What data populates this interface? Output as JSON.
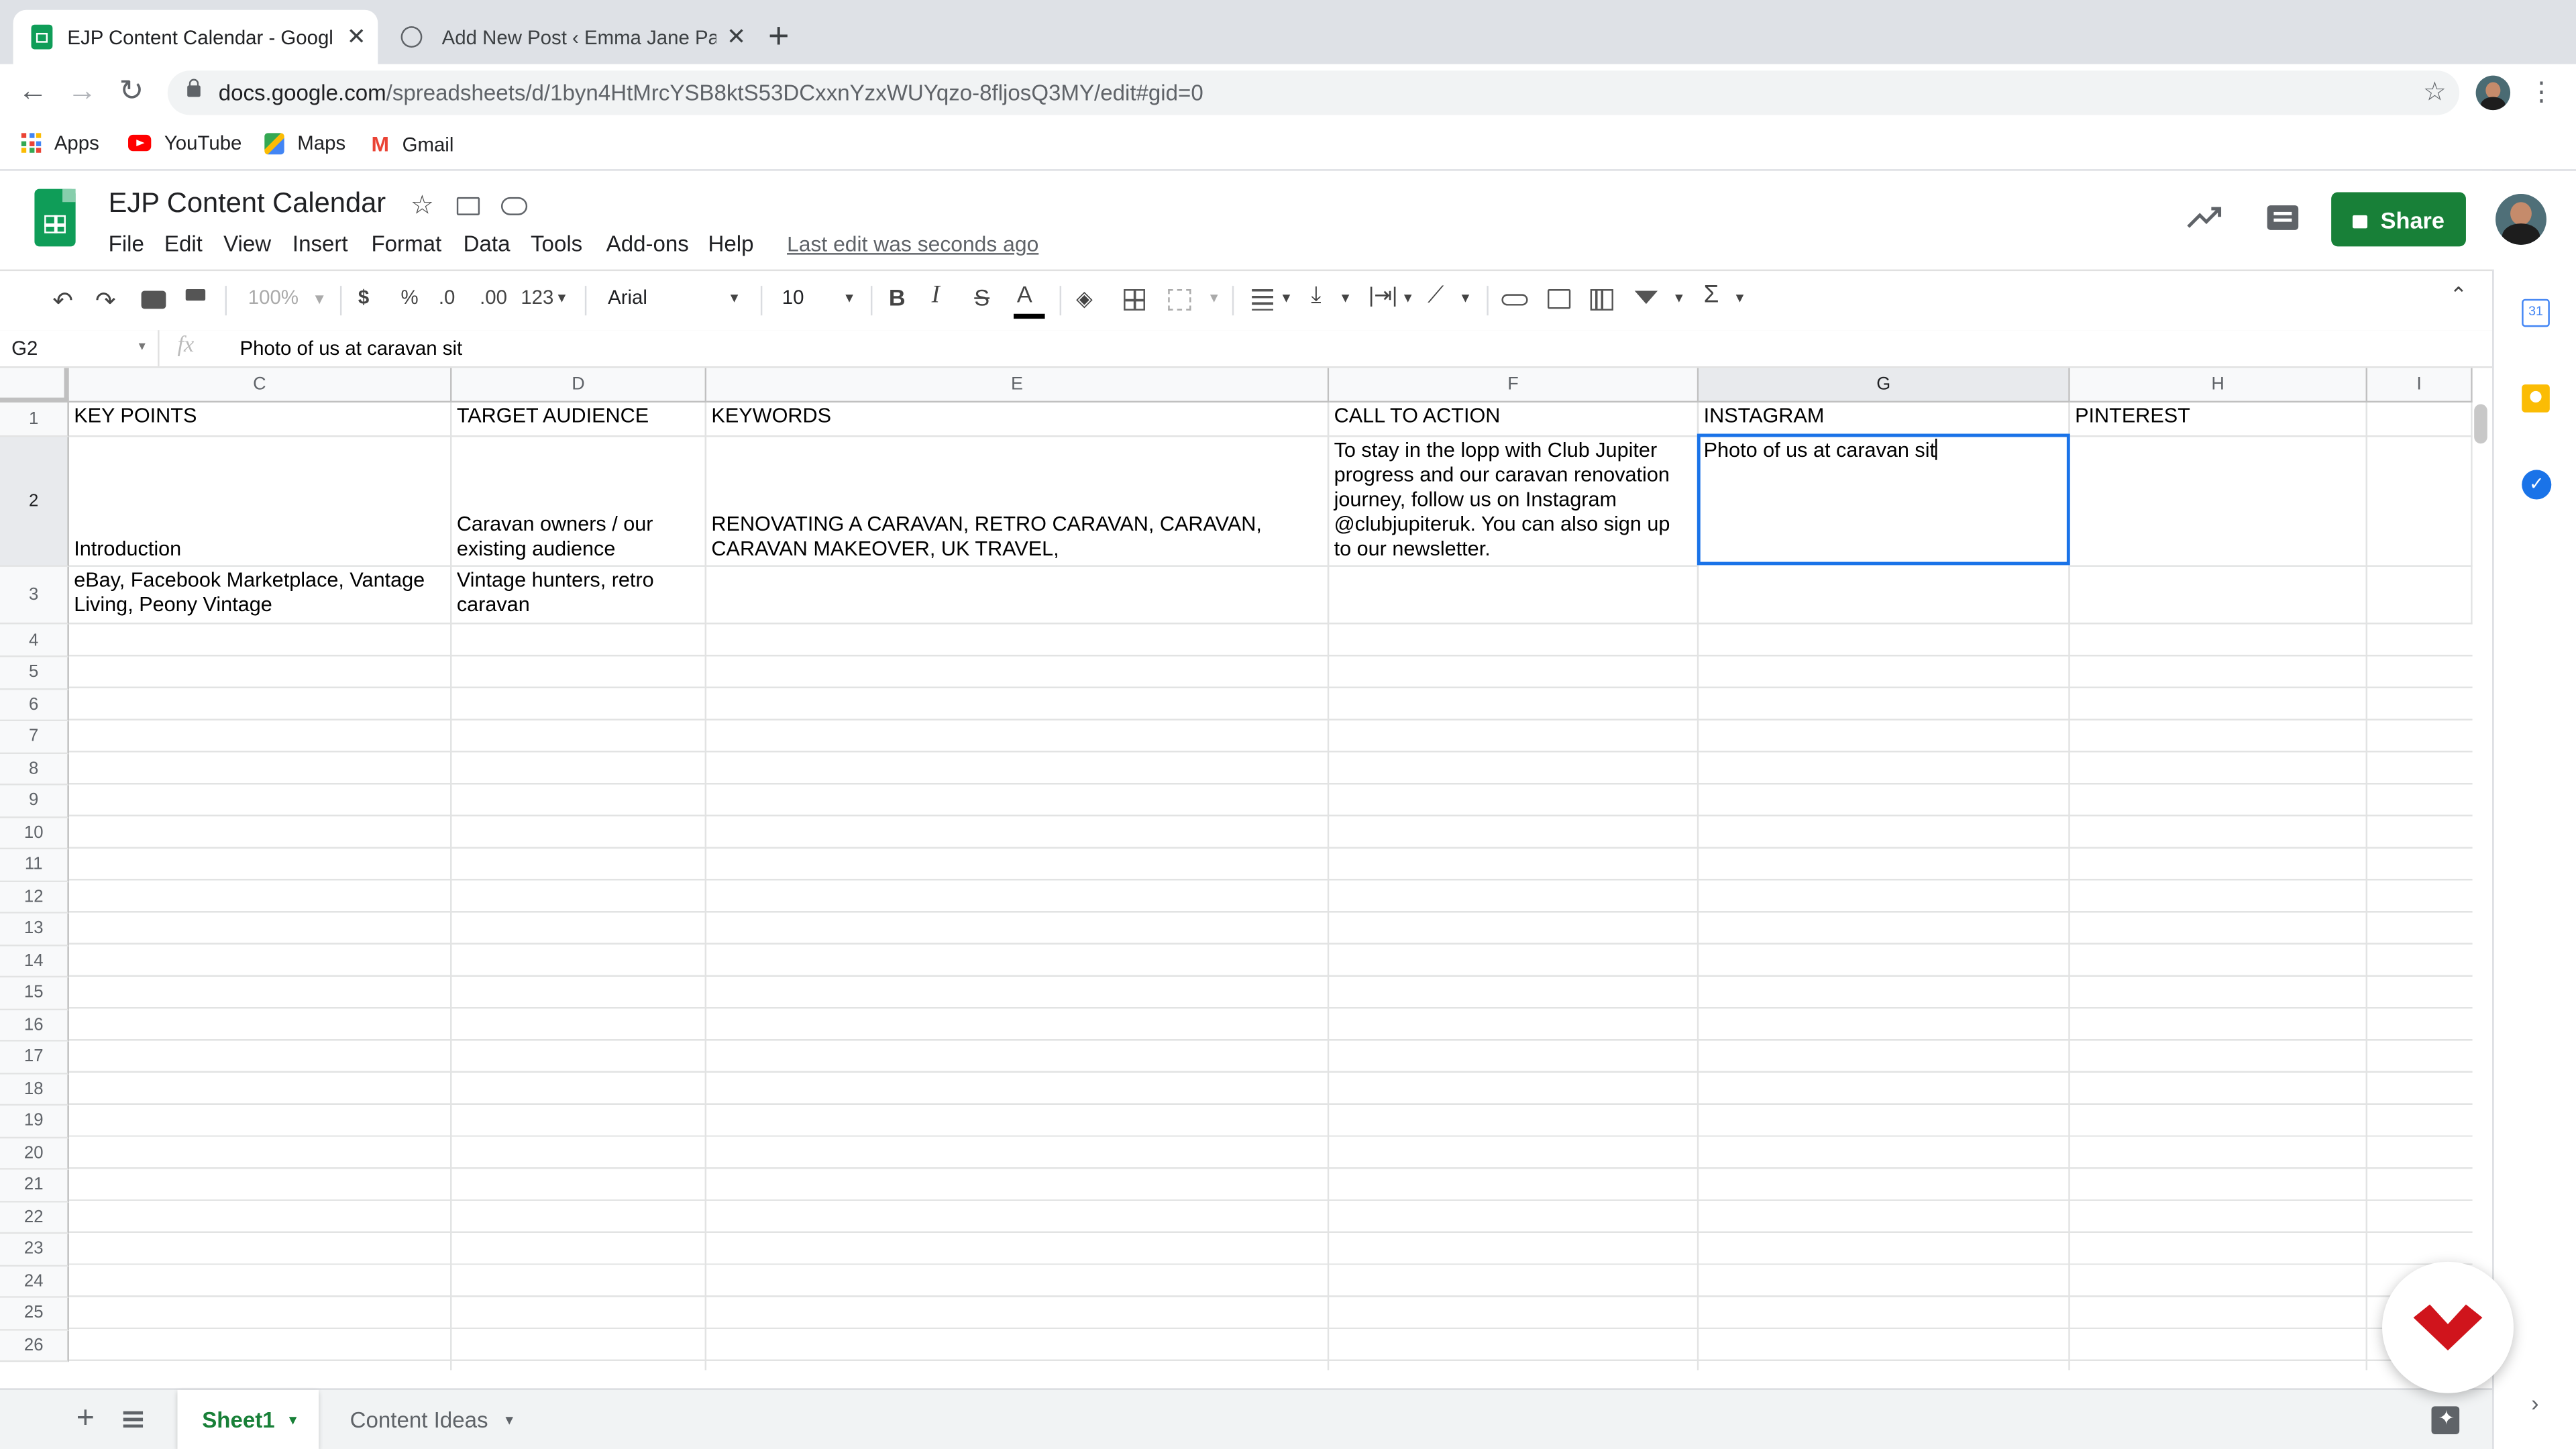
{
  "browser": {
    "tabs": [
      {
        "title": "EJP Content Calendar - Google",
        "active": true
      },
      {
        "title": "Add New Post ‹ Emma Jane Pa",
        "active": false
      }
    ],
    "url_host": "docs.google.com",
    "url_path": "/spreadsheets/d/1byn4HtMrcYSB8ktS53DCxxnYzxWUYqzo-8fljosQ3MY/edit#gid=0",
    "bookmarks": [
      "Apps",
      "YouTube",
      "Maps",
      "Gmail"
    ]
  },
  "doc": {
    "title": "EJP Content Calendar",
    "menu": [
      "File",
      "Edit",
      "View",
      "Insert",
      "Format",
      "Data",
      "Tools",
      "Add-ons",
      "Help"
    ],
    "last_edit": "Last edit was seconds ago",
    "share_label": "Share"
  },
  "toolbar": {
    "zoom": "100%",
    "currency": "$",
    "percent": "%",
    "dec_less": ".0",
    "dec_more": ".00",
    "format_more": "123",
    "font": "Arial",
    "font_size": "10"
  },
  "formula_bar": {
    "cell_ref": "G2",
    "fx": "fx",
    "content": "Photo of us at caravan sit"
  },
  "grid": {
    "columns": [
      "C",
      "D",
      "E",
      "F",
      "G",
      "H",
      "I"
    ],
    "rows": [
      "1",
      "2",
      "3",
      "4",
      "5",
      "6",
      "7",
      "8",
      "9",
      "10",
      "11",
      "12",
      "13",
      "14",
      "15",
      "16",
      "17",
      "18",
      "19",
      "20",
      "21",
      "22",
      "23",
      "24",
      "25",
      "26"
    ],
    "headers": {
      "c": "KEY POINTS",
      "d": "TARGET AUDIENCE",
      "e": "KEYWORDS",
      "f": "CALL TO ACTION",
      "g": "INSTAGRAM",
      "h": "PINTEREST"
    },
    "row2": {
      "c": "Introduction",
      "d": "Caravan owners / our existing audience",
      "e": "RENOVATING A CARAVAN, RETRO CARAVAN, CARAVAN, CARAVAN MAKEOVER, UK TRAVEL,",
      "f": "To stay in the lopp with Club Jupiter progress and our caravan renovation journey, follow us on Instagram @clubjupiteruk. You can also sign up to our newsletter.",
      "g": "Photo of us at caravan sit"
    },
    "row3": {
      "c": "eBay, Facebook Marketplace, Vantage Living, Peony Vintage",
      "d": "Vintage hunters, retro caravan"
    }
  },
  "sheets": [
    "Sheet1",
    "Content Ideas"
  ],
  "colors": {
    "share_green": "#188038",
    "selection_blue": "#1a73e8",
    "sheets_green": "#0f9d58"
  }
}
